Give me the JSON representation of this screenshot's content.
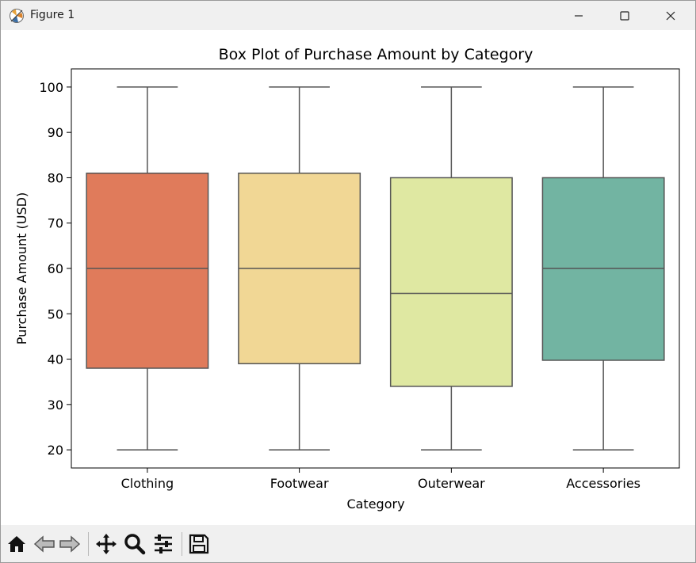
{
  "window": {
    "title": "Figure 1",
    "controls": [
      "minimize-icon",
      "maximize-icon",
      "close-icon"
    ]
  },
  "toolbar": {
    "icons": [
      "home-icon",
      "back-arrow-icon",
      "forward-arrow-icon",
      "pan-icon",
      "zoom-icon",
      "configure-subplots-icon",
      "save-icon"
    ]
  },
  "colors": {
    "Clothing": "#e07b5b",
    "Footwear": "#f1d795",
    "Outerwear": "#dfe8a2",
    "Accessories": "#72b4a2",
    "box_edge": "#555555"
  },
  "chart_data": {
    "type": "box",
    "title": "Box Plot of Purchase Amount by Category",
    "xlabel": "Category",
    "ylabel": "Purchase Amount (USD)",
    "categories": [
      "Clothing",
      "Footwear",
      "Outerwear",
      "Accessories"
    ],
    "boxes": [
      {
        "category": "Clothing",
        "min": 20,
        "q1": 38,
        "median": 60,
        "q3": 81,
        "max": 100
      },
      {
        "category": "Footwear",
        "min": 20,
        "q1": 39,
        "median": 60,
        "q3": 81,
        "max": 100
      },
      {
        "category": "Outerwear",
        "min": 20,
        "q1": 34,
        "median": 54.5,
        "q3": 80,
        "max": 100
      },
      {
        "category": "Accessories",
        "min": 20,
        "q1": 39.75,
        "median": 60,
        "q3": 80,
        "max": 100
      }
    ],
    "yticks": [
      20,
      30,
      40,
      50,
      60,
      70,
      80,
      90,
      100
    ],
    "ylim": [
      16,
      104
    ],
    "grid": false,
    "legend": "none"
  }
}
